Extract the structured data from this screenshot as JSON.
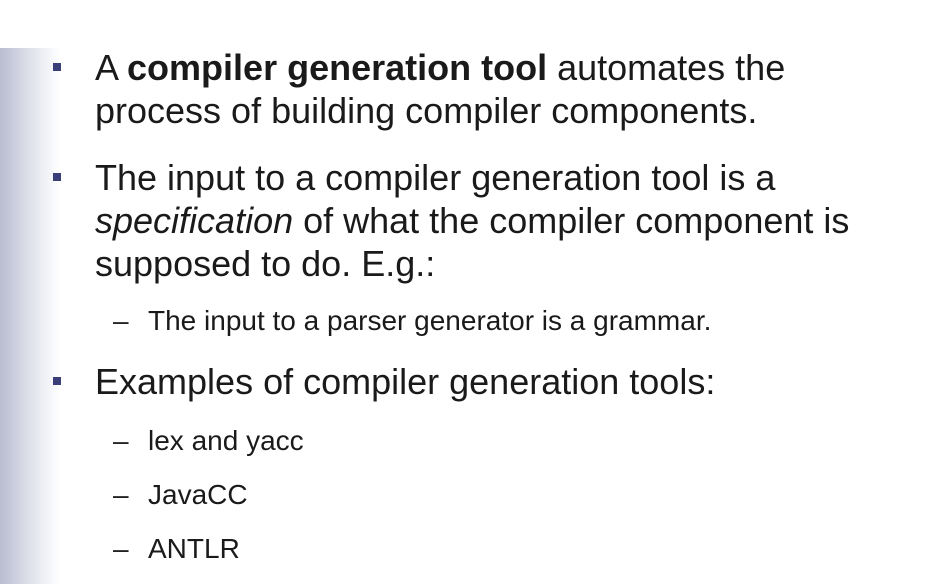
{
  "bullets": [
    {
      "pre": "A ",
      "bold": "compiler generation tool",
      "post": " automates the process of building compiler components."
    },
    {
      "pre": "The input to a compiler generation tool is a ",
      "italic": "specification",
      "post": " of what the compiler component is supposed to do. E.g.:",
      "sub": [
        "The input to a parser generator is a grammar."
      ]
    },
    {
      "text": "Examples of compiler generation tools:",
      "sub": [
        "lex and yacc",
        "JavaCC",
        "ANTLR"
      ]
    }
  ],
  "dash_glyph": "–"
}
